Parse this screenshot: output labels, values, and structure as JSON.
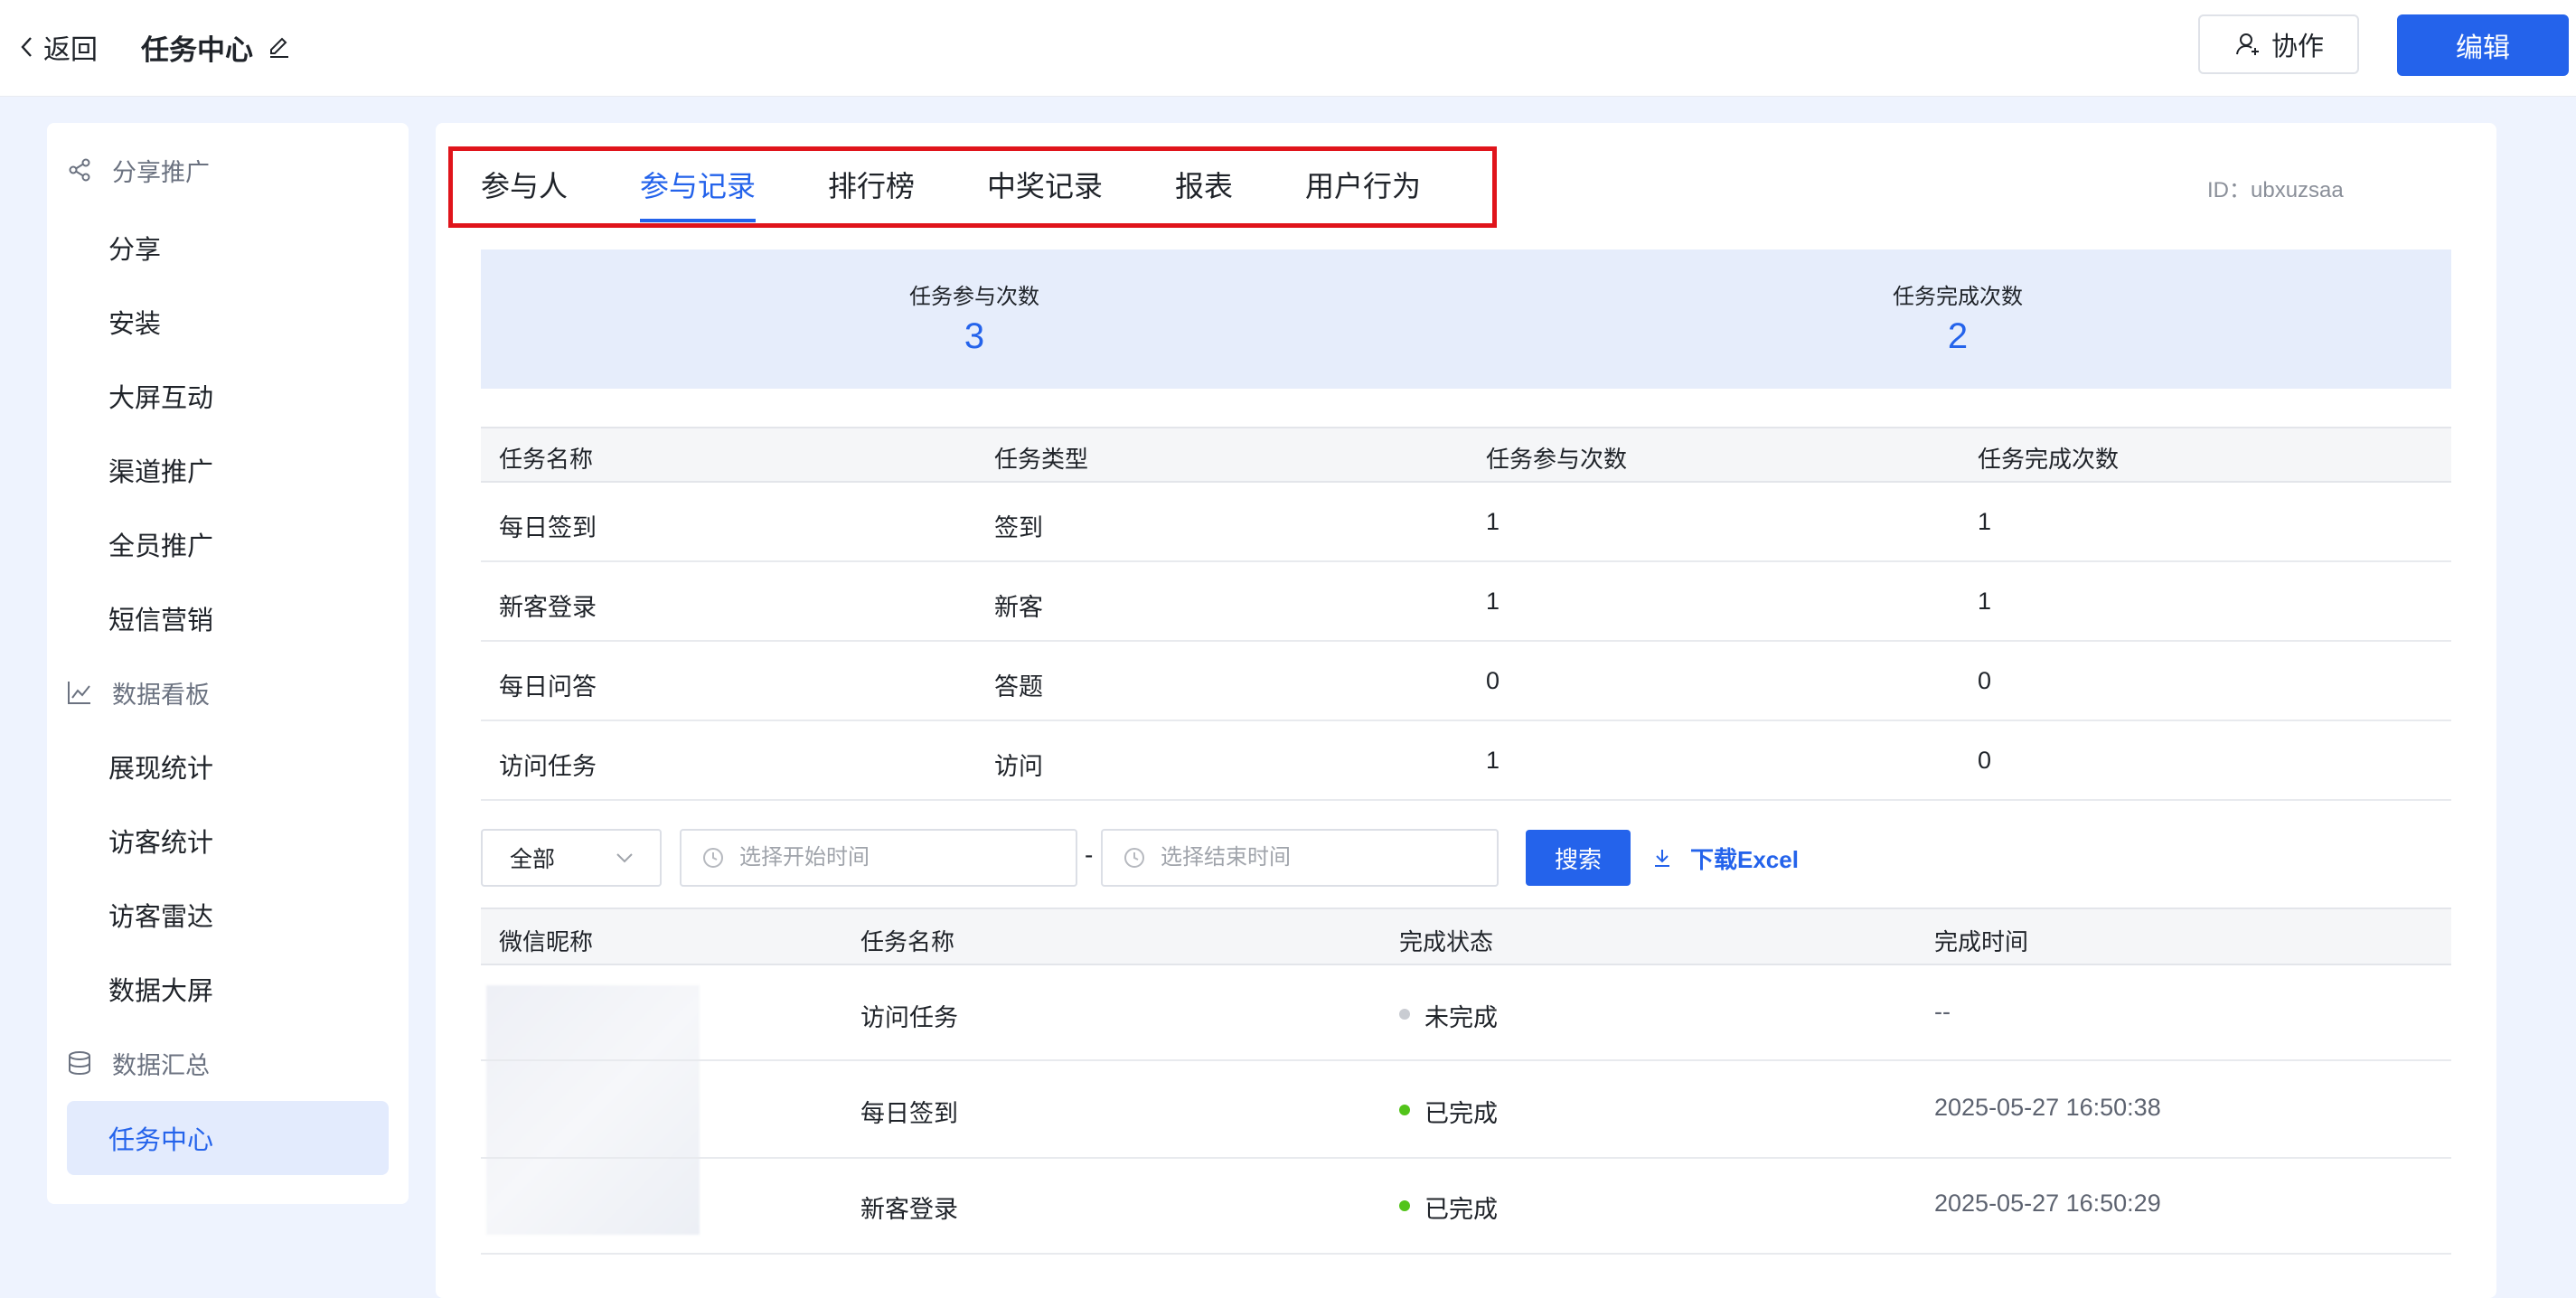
{
  "header": {
    "back_label": "返回",
    "title": "任务中心",
    "collab_label": "协作",
    "edit_label": "编辑"
  },
  "sidebar": {
    "groups": [
      {
        "label": "分享推广",
        "icon": "share-icon"
      },
      {
        "label": "数据看板",
        "icon": "line-chart-icon"
      },
      {
        "label": "数据汇总",
        "icon": "database-icon"
      }
    ],
    "items": [
      "分享",
      "安装",
      "大屏互动",
      "渠道推广",
      "全员推广",
      "短信营销",
      "展现统计",
      "访客统计",
      "访客雷达",
      "数据大屏",
      "任务中心"
    ],
    "active_item": "任务中心"
  },
  "tabs": [
    "参与人",
    "参与记录",
    "排行榜",
    "中奖记录",
    "报表",
    "用户行为"
  ],
  "active_tab": "参与记录",
  "id_label": "ID：ubxuzsaa",
  "stats": [
    {
      "label": "任务参与次数",
      "value": "3"
    },
    {
      "label": "任务完成次数",
      "value": "2"
    }
  ],
  "summary_table": {
    "headers": [
      "任务名称",
      "任务类型",
      "任务参与次数",
      "任务完成次数"
    ],
    "rows": [
      [
        "每日签到",
        "签到",
        "1",
        "1"
      ],
      [
        "新客登录",
        "新客",
        "1",
        "1"
      ],
      [
        "每日问答",
        "答题",
        "0",
        "0"
      ],
      [
        "访问任务",
        "访问",
        "1",
        "0"
      ]
    ]
  },
  "filters": {
    "select_value": "全部",
    "start_placeholder": "选择开始时间",
    "end_placeholder": "选择结束时间",
    "separator": "-",
    "search_label": "搜索",
    "download_label": "下载Excel"
  },
  "records_table": {
    "headers": [
      "微信昵称",
      "任务名称",
      "完成状态",
      "完成时间"
    ],
    "rows": [
      {
        "task": "访问任务",
        "status": "未完成",
        "status_color": "#c9ccd2",
        "time": "--"
      },
      {
        "task": "每日签到",
        "status": "已完成",
        "status_color": "#52c41a",
        "time": "2025-05-27 16:50:38"
      },
      {
        "task": "新客登录",
        "status": "已完成",
        "status_color": "#52c41a",
        "time": "2025-05-27 16:50:29"
      }
    ]
  },
  "colors": {
    "primary": "#2463eb",
    "highlight_box": "#e0141b",
    "page_bg": "#eef3fe"
  }
}
